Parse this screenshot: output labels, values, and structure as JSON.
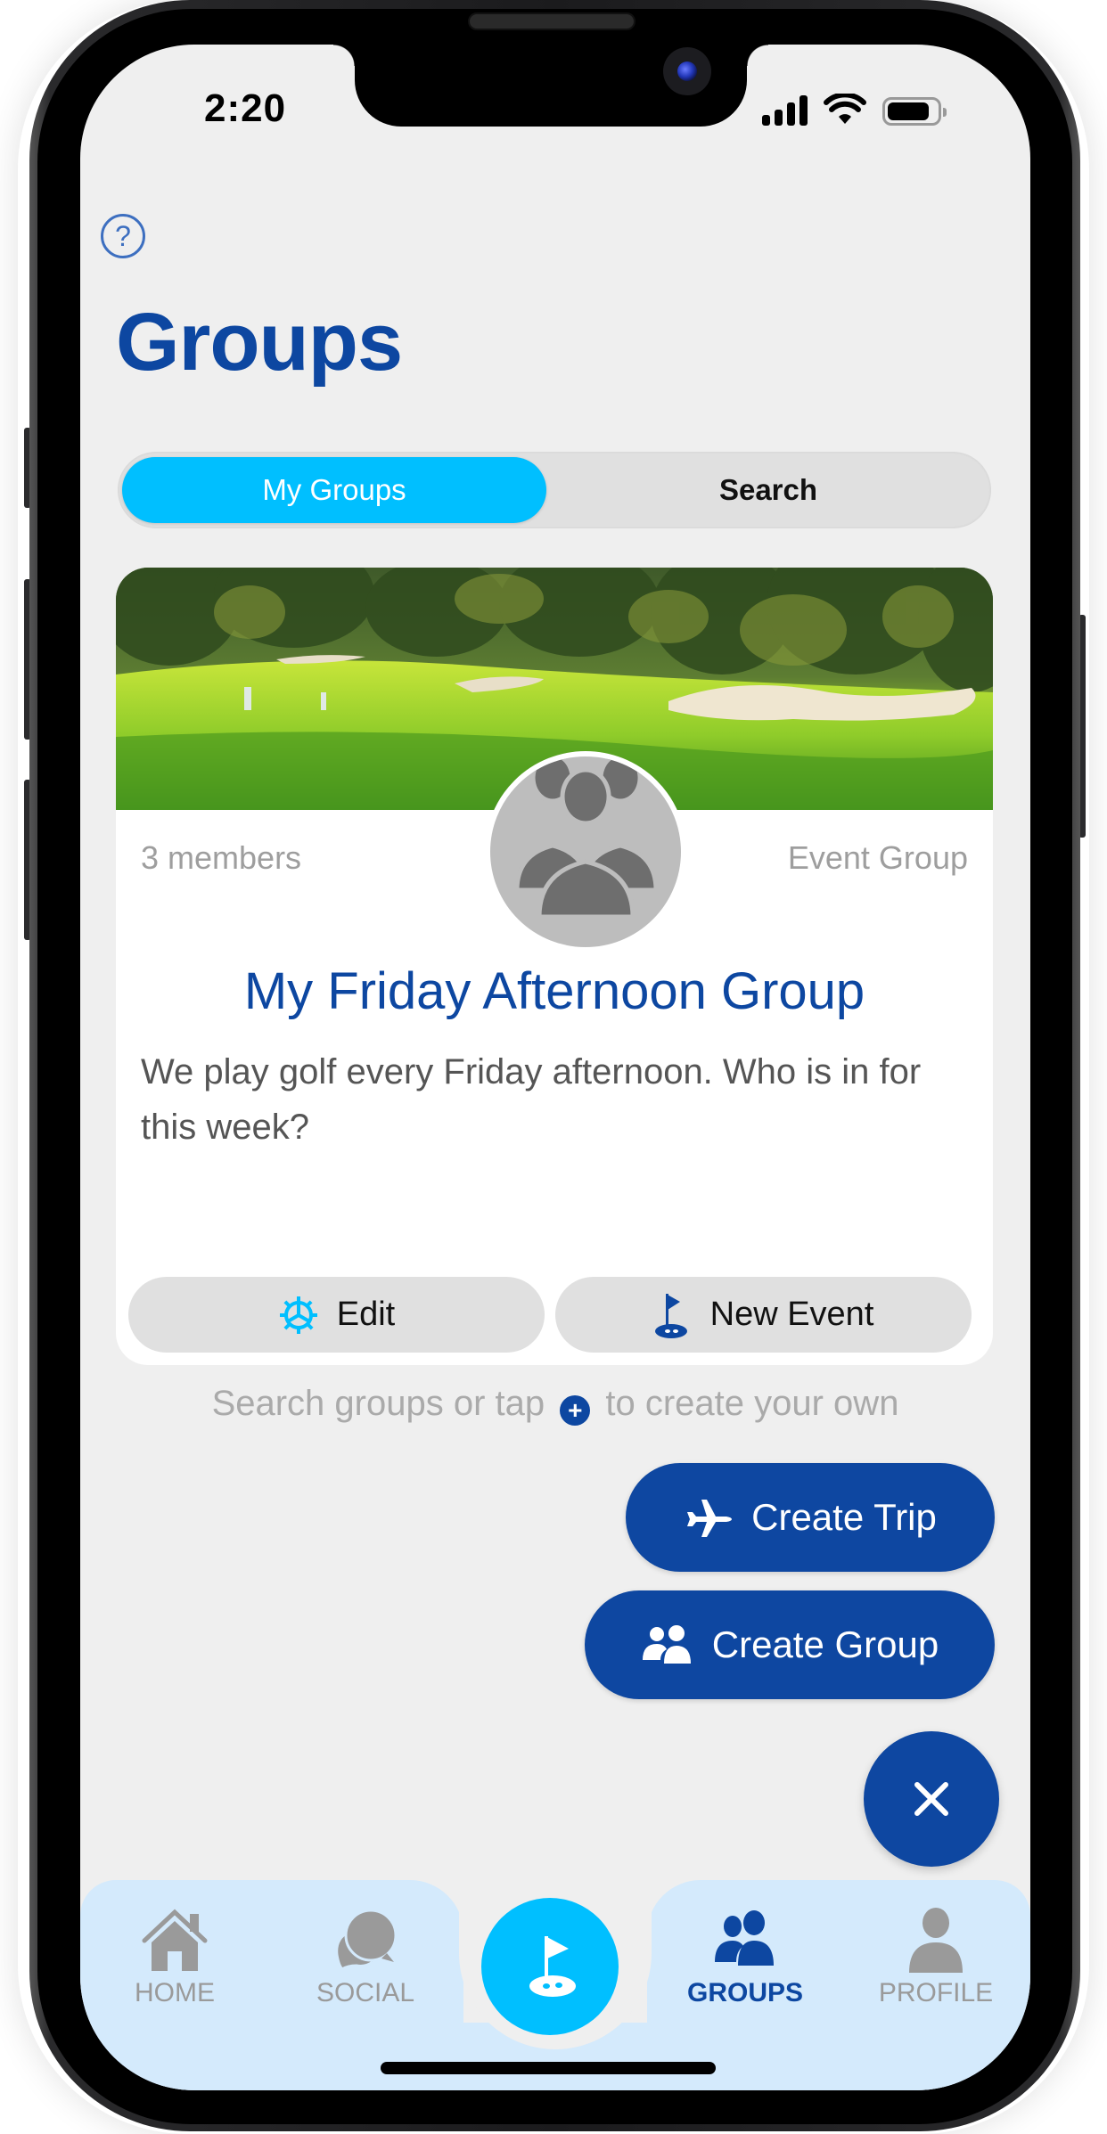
{
  "status_bar": {
    "time": "2:20",
    "battery_level": 0.85,
    "signal_bars": 4
  },
  "header": {
    "help_icon": "question-circle-icon",
    "title": "Groups"
  },
  "segmented_control": {
    "tabs": [
      {
        "label": "My Groups",
        "selected": true
      },
      {
        "label": "Search",
        "selected": false
      }
    ]
  },
  "group_card": {
    "banner": "golf-course-photo",
    "avatar_icon": "group-silhouette-icon",
    "members": "3 members",
    "type": "Event Group",
    "name": "My Friday Afternoon Group",
    "description": "We play golf every Friday afternoon. Who is in for this week?",
    "actions": [
      {
        "label": "Edit",
        "icon": "gear-icon"
      },
      {
        "label": "New Event",
        "icon": "golf-flag-icon"
      }
    ]
  },
  "hint": {
    "before": "Search groups or tap",
    "after": "to create your own",
    "icon": "plus-circle-icon"
  },
  "fab_menu": {
    "create_trip": {
      "label": "Create Trip",
      "icon": "airplane-icon"
    },
    "create_group": {
      "label": "Create Group",
      "icon": "people-icon"
    },
    "close_icon": "close-icon"
  },
  "tab_bar": {
    "items": [
      {
        "label": "HOME",
        "icon": "home-icon",
        "active": false
      },
      {
        "label": "SOCIAL",
        "icon": "chat-bubbles-icon",
        "active": false
      },
      {
        "label": "GROUPS",
        "icon": "people-icon",
        "active": true
      },
      {
        "label": "PROFILE",
        "icon": "person-icon",
        "active": false
      }
    ],
    "center_icon": "golf-flag-icon"
  },
  "colors": {
    "brand_dark_blue": "#0e47a1",
    "accent_cyan": "#00bfff",
    "background": "#efefef",
    "tab_bar_bg": "#d4eafc",
    "muted_text": "#9e9e9e"
  }
}
